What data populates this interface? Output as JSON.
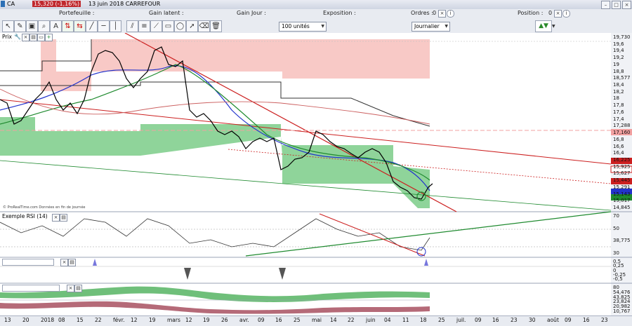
{
  "title_bar": {
    "ticker": "CA",
    "price_change": "15,320 (-1,16%)",
    "date_name": "13 juin 2018 CARREFOUR"
  },
  "toolbar": {
    "portefeuille_label": "Portefeuille :",
    "gain_latent_label": "Gain latent :",
    "gain_jour_label": "Gain Jour :",
    "exposition_label": "Exposition :",
    "ordres_label": "Ordres :",
    "ordres_value": "0",
    "position_label": "Position :",
    "position_value": "0",
    "quantity_select": "100 unités",
    "period_select": "Journalier"
  },
  "price_panel": {
    "label": "Prix",
    "source": "© ProRealTime.com Données en fin de journée",
    "axis_ticks": [
      "19,730",
      "19,6",
      "19,4",
      "19,2",
      "19",
      "18,8",
      "18,577",
      "18,4",
      "18,2",
      "18",
      "17,8",
      "17,6",
      "17,4",
      "17,288",
      "17,160",
      "16,8",
      "16,6",
      "16,4",
      "16,225",
      "15,925",
      "15,627",
      "15,445",
      "15,291",
      "15,143",
      "15,017",
      "14,845"
    ]
  },
  "rsi_panel": {
    "label": "Exemple RSI (14)",
    "axis_ticks": [
      "70",
      "50",
      "38,775",
      "30"
    ]
  },
  "ind2_panel": {
    "axis_ticks": [
      "0,5",
      "0,25",
      "0",
      "-0,25",
      "-0,5"
    ]
  },
  "ind3_panel": {
    "axis_ticks": [
      "80",
      "54,476",
      "43,825",
      "23,824",
      "20,982",
      "10,767"
    ]
  },
  "date_axis": [
    "13",
    "20",
    "2018",
    "08",
    "15",
    "22",
    "févr.",
    "12",
    "19",
    "mars",
    "12",
    "19",
    "26",
    "avr.",
    "09",
    "16",
    "25",
    "mai",
    "14",
    "22",
    "juin",
    "04",
    "11",
    "18",
    "25",
    "juil.",
    "09",
    "16",
    "23",
    "30",
    "août",
    "09",
    "16",
    "23"
  ],
  "colors": {
    "up_band": "#f4a6a3",
    "down_band": "#7fcf86",
    "blue_ma": "#2233cc",
    "green_ma": "#1f8a2f",
    "red_trend": "#cc1f1f"
  }
}
